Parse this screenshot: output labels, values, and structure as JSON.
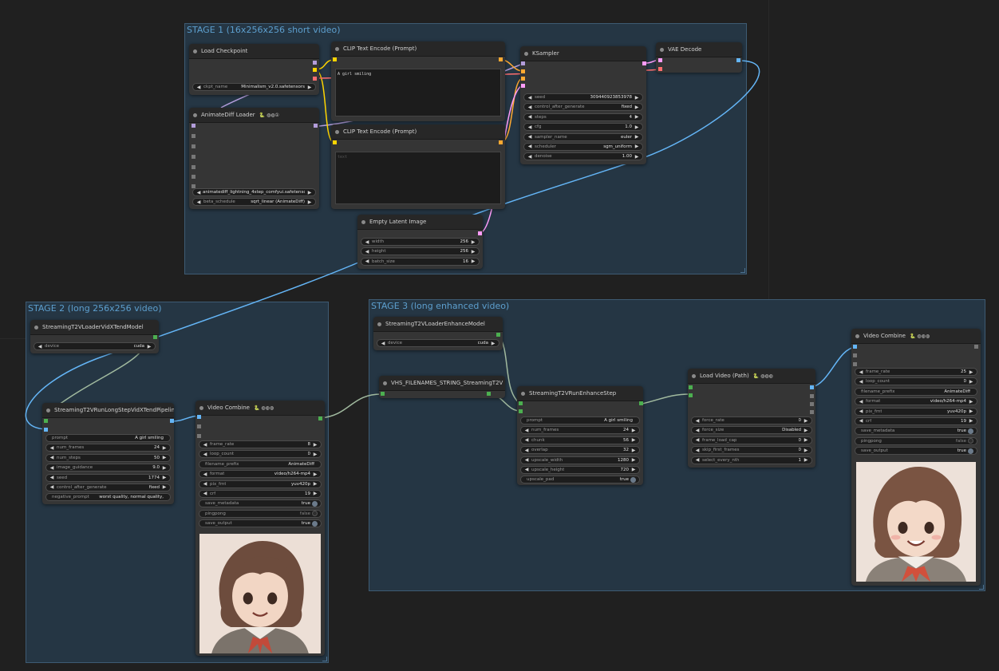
{
  "colors": {
    "canvas": "#202020",
    "group_bg": "#253644",
    "group_title": "#5d9fce",
    "link_model": "#b39ddb",
    "link_clip": "#ffd500",
    "link_conditioning": "#ffa931",
    "link_latent": "#ff9cf9",
    "link_vae": "#ff6e6e",
    "link_image": "#64b5f6",
    "link_generic": "#a1ba9f",
    "port_image": "#64b5f6",
    "port_generic": "#4caf50",
    "toggle_on": "#6b7a8a"
  },
  "groups": {
    "stage1": {
      "title": "STAGE 1 (16x256x256 short video)"
    },
    "stage2": {
      "title": "STAGE 2 (long 256x256 video)"
    },
    "stage3": {
      "title": "STAGE 3 (long enhanced video)"
    }
  },
  "nodes": {
    "load_checkpoint": {
      "title": "Load Checkpoint",
      "widgets": [
        {
          "label": "ckpt_name",
          "value": "Minimalism_v2.0.safetensors"
        }
      ]
    },
    "clip_text_pos": {
      "title": "CLIP Text Encode (Prompt)",
      "text": "A girl smiling"
    },
    "clip_text_neg": {
      "title": "CLIP Text Encode (Prompt)",
      "text": "text"
    },
    "ksampler": {
      "title": "KSampler",
      "widgets": [
        {
          "label": "seed",
          "value": "309440923853978"
        },
        {
          "label": "control_after_generate",
          "value": "fixed"
        },
        {
          "label": "steps",
          "value": "4"
        },
        {
          "label": "cfg",
          "value": "1.0"
        },
        {
          "label": "sampler_name",
          "value": "euler"
        },
        {
          "label": "scheduler",
          "value": "sgm_uniform"
        },
        {
          "label": "denoise",
          "value": "1.00"
        }
      ]
    },
    "vae_decode": {
      "title": "VAE Decode"
    },
    "animatediff_loader": {
      "title": "AnimateDiff Loader",
      "badge": "🐍 ◍◍①",
      "widgets": [
        {
          "label": "model_name",
          "value": "animatediff_lightning_4step_comfyui.safetensors"
        },
        {
          "label": "beta_schedule",
          "value": "sqrt_linear (AnimateDiff)"
        }
      ]
    },
    "empty_latent": {
      "title": "Empty Latent Image",
      "widgets": [
        {
          "label": "width",
          "value": "256"
        },
        {
          "label": "height",
          "value": "256"
        },
        {
          "label": "batch_size",
          "value": "16"
        }
      ]
    },
    "s2_loader": {
      "title": "StreamingT2VLoaderVidXTendModel",
      "widgets": [
        {
          "label": "device",
          "value": "cuda"
        }
      ]
    },
    "s2_pipeline": {
      "title": "StreamingT2VRunLongStepVidXTendPipeline",
      "widgets": [
        {
          "label": "prompt",
          "value": "A girl smiling"
        },
        {
          "label": "num_frames",
          "value": "24"
        },
        {
          "label": "num_steps",
          "value": "50"
        },
        {
          "label": "image_guidance",
          "value": "9.0"
        },
        {
          "label": "seed",
          "value": "1774"
        },
        {
          "label": "control_after_generate",
          "value": "fixed"
        },
        {
          "label": "negative_prompt",
          "value": "worst quality, normal quality,"
        }
      ]
    },
    "s2_combine": {
      "title": "Video Combine",
      "badge": "🐍 ◍◍◍",
      "widgets": [
        {
          "label": "frame_rate",
          "value": "8"
        },
        {
          "label": "loop_count",
          "value": "0"
        },
        {
          "label": "filename_prefix",
          "value": "AnimateDiff"
        },
        {
          "label": "format",
          "value": "video/h264-mp4"
        },
        {
          "label": "pix_fmt",
          "value": "yuv420p"
        },
        {
          "label": "crf",
          "value": "19"
        },
        {
          "label": "save_metadata",
          "value": "true"
        },
        {
          "label": "pingpong",
          "value": "false"
        },
        {
          "label": "save_output",
          "value": "true"
        }
      ]
    },
    "s3_loader": {
      "title": "StreamingT2VLoaderEnhanceModel",
      "widgets": [
        {
          "label": "device",
          "value": "cuda"
        }
      ]
    },
    "vhs_filenames": {
      "title": "VHS_FILENAMES_STRING_StreamingT2V"
    },
    "s3_enhance": {
      "title": "StreamingT2VRunEnhanceStep",
      "widgets": [
        {
          "label": "prompt",
          "value": "A girl smiling"
        },
        {
          "label": "num_frames",
          "value": "24"
        },
        {
          "label": "chunk",
          "value": "56"
        },
        {
          "label": "overlap",
          "value": "32"
        },
        {
          "label": "upscale_width",
          "value": "1280"
        },
        {
          "label": "upscale_height",
          "value": "720"
        },
        {
          "label": "upscale_pad",
          "value": "true"
        }
      ]
    },
    "load_video": {
      "title": "Load Video (Path)",
      "badge": "🐍 ◍◍◍",
      "widgets": [
        {
          "label": "force_rate",
          "value": "0"
        },
        {
          "label": "force_size",
          "value": "Disabled"
        },
        {
          "label": "frame_load_cap",
          "value": "0"
        },
        {
          "label": "skip_first_frames",
          "value": "0"
        },
        {
          "label": "select_every_nth",
          "value": "1"
        }
      ]
    },
    "s3_combine": {
      "title": "Video Combine",
      "badge": "🐍 ◍◍◍",
      "widgets": [
        {
          "label": "frame_rate",
          "value": "25"
        },
        {
          "label": "loop_count",
          "value": "0"
        },
        {
          "label": "filename_prefix",
          "value": "AnimateDiff"
        },
        {
          "label": "format",
          "value": "video/h264-mp4"
        },
        {
          "label": "pix_fmt",
          "value": "yuv420p"
        },
        {
          "label": "crf",
          "value": "19"
        },
        {
          "label": "save_metadata",
          "value": "true"
        },
        {
          "label": "pingpong",
          "value": "false"
        },
        {
          "label": "save_output",
          "value": "true"
        }
      ]
    }
  }
}
